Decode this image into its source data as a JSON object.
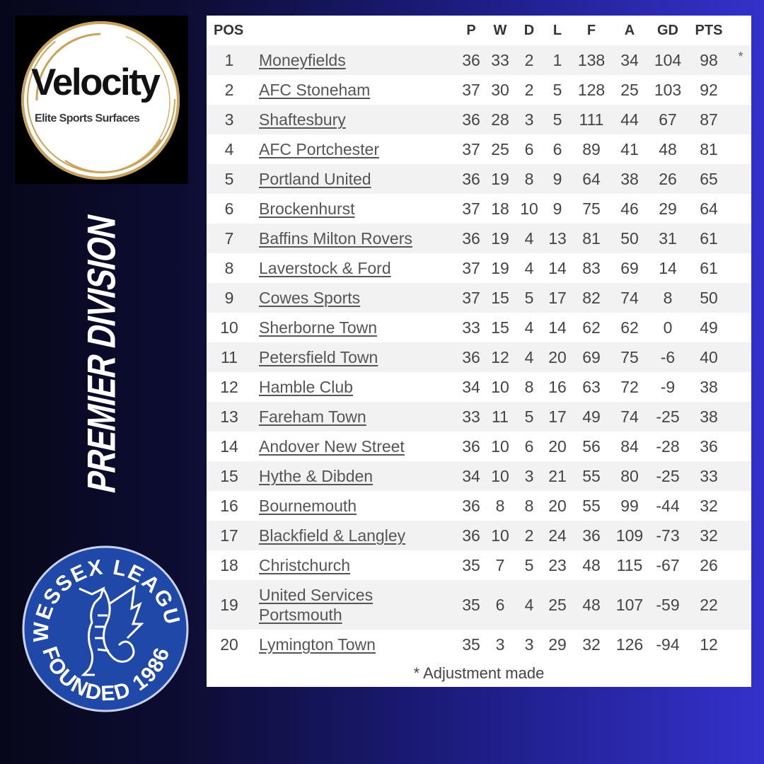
{
  "sponsor": {
    "name": "Velocity",
    "tagline": "Elite Sports Surfaces",
    "ring_color": "#c9a35b"
  },
  "division_title": "PREMIER DIVISION",
  "league_badge": {
    "top_text": "WESSEX LEAGUE",
    "bottom_text": "FOUNDED 1986",
    "color": "#1f48a8",
    "icon": "wyvern-icon"
  },
  "table": {
    "headers": {
      "pos": "POS",
      "team": "",
      "p": "P",
      "w": "W",
      "d": "D",
      "l": "L",
      "f": "F",
      "a": "A",
      "gd": "GD",
      "pts": "PTS"
    },
    "rows": [
      {
        "pos": "1",
        "team": "Moneyfields",
        "p": "36",
        "w": "33",
        "d": "2",
        "l": "1",
        "f": "138",
        "a": "34",
        "gd": "104",
        "pts": "98",
        "mark": "*"
      },
      {
        "pos": "2",
        "team": "AFC Stoneham",
        "p": "37",
        "w": "30",
        "d": "2",
        "l": "5",
        "f": "128",
        "a": "25",
        "gd": "103",
        "pts": "92",
        "mark": ""
      },
      {
        "pos": "3",
        "team": "Shaftesbury",
        "p": "36",
        "w": "28",
        "d": "3",
        "l": "5",
        "f": "111",
        "a": "44",
        "gd": "67",
        "pts": "87",
        "mark": ""
      },
      {
        "pos": "4",
        "team": "AFC Portchester",
        "p": "37",
        "w": "25",
        "d": "6",
        "l": "6",
        "f": "89",
        "a": "41",
        "gd": "48",
        "pts": "81",
        "mark": ""
      },
      {
        "pos": "5",
        "team": "Portland United",
        "p": "36",
        "w": "19",
        "d": "8",
        "l": "9",
        "f": "64",
        "a": "38",
        "gd": "26",
        "pts": "65",
        "mark": ""
      },
      {
        "pos": "6",
        "team": "Brockenhurst",
        "p": "37",
        "w": "18",
        "d": "10",
        "l": "9",
        "f": "75",
        "a": "46",
        "gd": "29",
        "pts": "64",
        "mark": ""
      },
      {
        "pos": "7",
        "team": "Baffins Milton Rovers",
        "p": "36",
        "w": "19",
        "d": "4",
        "l": "13",
        "f": "81",
        "a": "50",
        "gd": "31",
        "pts": "61",
        "mark": ""
      },
      {
        "pos": "8",
        "team": "Laverstock & Ford",
        "p": "37",
        "w": "19",
        "d": "4",
        "l": "14",
        "f": "83",
        "a": "69",
        "gd": "14",
        "pts": "61",
        "mark": ""
      },
      {
        "pos": "9",
        "team": "Cowes Sports",
        "p": "37",
        "w": "15",
        "d": "5",
        "l": "17",
        "f": "82",
        "a": "74",
        "gd": "8",
        "pts": "50",
        "mark": ""
      },
      {
        "pos": "10",
        "team": "Sherborne Town",
        "p": "33",
        "w": "15",
        "d": "4",
        "l": "14",
        "f": "62",
        "a": "62",
        "gd": "0",
        "pts": "49",
        "mark": ""
      },
      {
        "pos": "11",
        "team": "Petersfield Town",
        "p": "36",
        "w": "12",
        "d": "4",
        "l": "20",
        "f": "69",
        "a": "75",
        "gd": "-6",
        "pts": "40",
        "mark": ""
      },
      {
        "pos": "12",
        "team": "Hamble Club",
        "p": "34",
        "w": "10",
        "d": "8",
        "l": "16",
        "f": "63",
        "a": "72",
        "gd": "-9",
        "pts": "38",
        "mark": ""
      },
      {
        "pos": "13",
        "team": "Fareham Town",
        "p": "33",
        "w": "11",
        "d": "5",
        "l": "17",
        "f": "49",
        "a": "74",
        "gd": "-25",
        "pts": "38",
        "mark": ""
      },
      {
        "pos": "14",
        "team": "Andover New Street",
        "p": "36",
        "w": "10",
        "d": "6",
        "l": "20",
        "f": "56",
        "a": "84",
        "gd": "-28",
        "pts": "36",
        "mark": ""
      },
      {
        "pos": "15",
        "team": "Hythe & Dibden",
        "p": "34",
        "w": "10",
        "d": "3",
        "l": "21",
        "f": "55",
        "a": "80",
        "gd": "-25",
        "pts": "33",
        "mark": ""
      },
      {
        "pos": "16",
        "team": "Bournemouth",
        "p": "36",
        "w": "8",
        "d": "8",
        "l": "20",
        "f": "55",
        "a": "99",
        "gd": "-44",
        "pts": "32",
        "mark": ""
      },
      {
        "pos": "17",
        "team": "Blackfield & Langley",
        "p": "36",
        "w": "10",
        "d": "2",
        "l": "24",
        "f": "36",
        "a": "109",
        "gd": "-73",
        "pts": "32",
        "mark": ""
      },
      {
        "pos": "18",
        "team": "Christchurch",
        "p": "35",
        "w": "7",
        "d": "5",
        "l": "23",
        "f": "48",
        "a": "115",
        "gd": "-67",
        "pts": "26",
        "mark": ""
      },
      {
        "pos": "19",
        "team": "United Services Portsmouth",
        "p": "35",
        "w": "6",
        "d": "4",
        "l": "25",
        "f": "48",
        "a": "107",
        "gd": "-59",
        "pts": "22",
        "mark": ""
      },
      {
        "pos": "20",
        "team": "Lymington Town",
        "p": "35",
        "w": "3",
        "d": "3",
        "l": "29",
        "f": "32",
        "a": "126",
        "gd": "-94",
        "pts": "12",
        "mark": ""
      }
    ],
    "footnote": "* Adjustment made"
  }
}
